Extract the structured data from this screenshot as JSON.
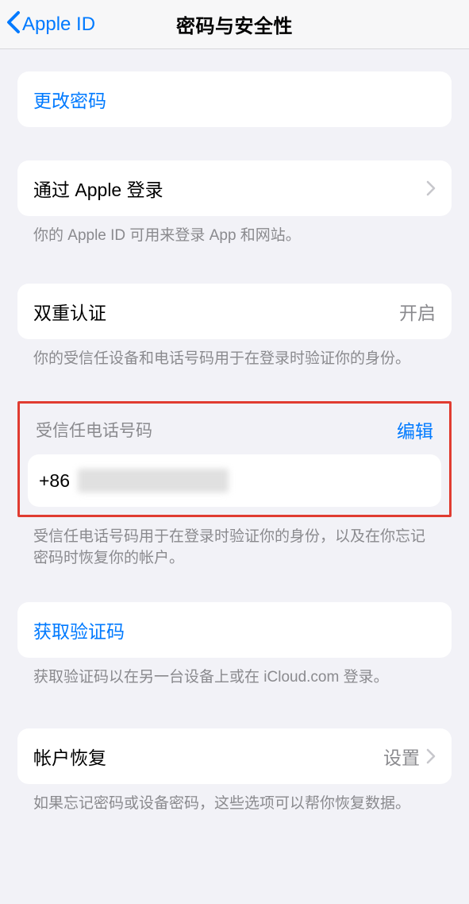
{
  "nav": {
    "back_label": "Apple ID",
    "title": "密码与安全性"
  },
  "change_password": {
    "label": "更改密码"
  },
  "sign_in_with_apple": {
    "label": "通过 Apple 登录",
    "footer": "你的 Apple ID 可用来登录 App 和网站。"
  },
  "two_factor": {
    "label": "双重认证",
    "value": "开启",
    "footer": "你的受信任设备和电话号码用于在登录时验证你的身份。"
  },
  "trusted_phone": {
    "header": "受信任电话号码",
    "edit": "编辑",
    "prefix": "+86",
    "footer": "受信任电话号码用于在登录时验证你的身份，以及在你忘记密码时恢复你的帐户。"
  },
  "get_code": {
    "label": "获取验证码",
    "footer": "获取验证码以在另一台设备上或在 iCloud.com 登录。"
  },
  "account_recovery": {
    "label": "帐户恢复",
    "value": "设置",
    "footer": "如果忘记密码或设备密码，这些选项可以帮你恢复数据。"
  }
}
